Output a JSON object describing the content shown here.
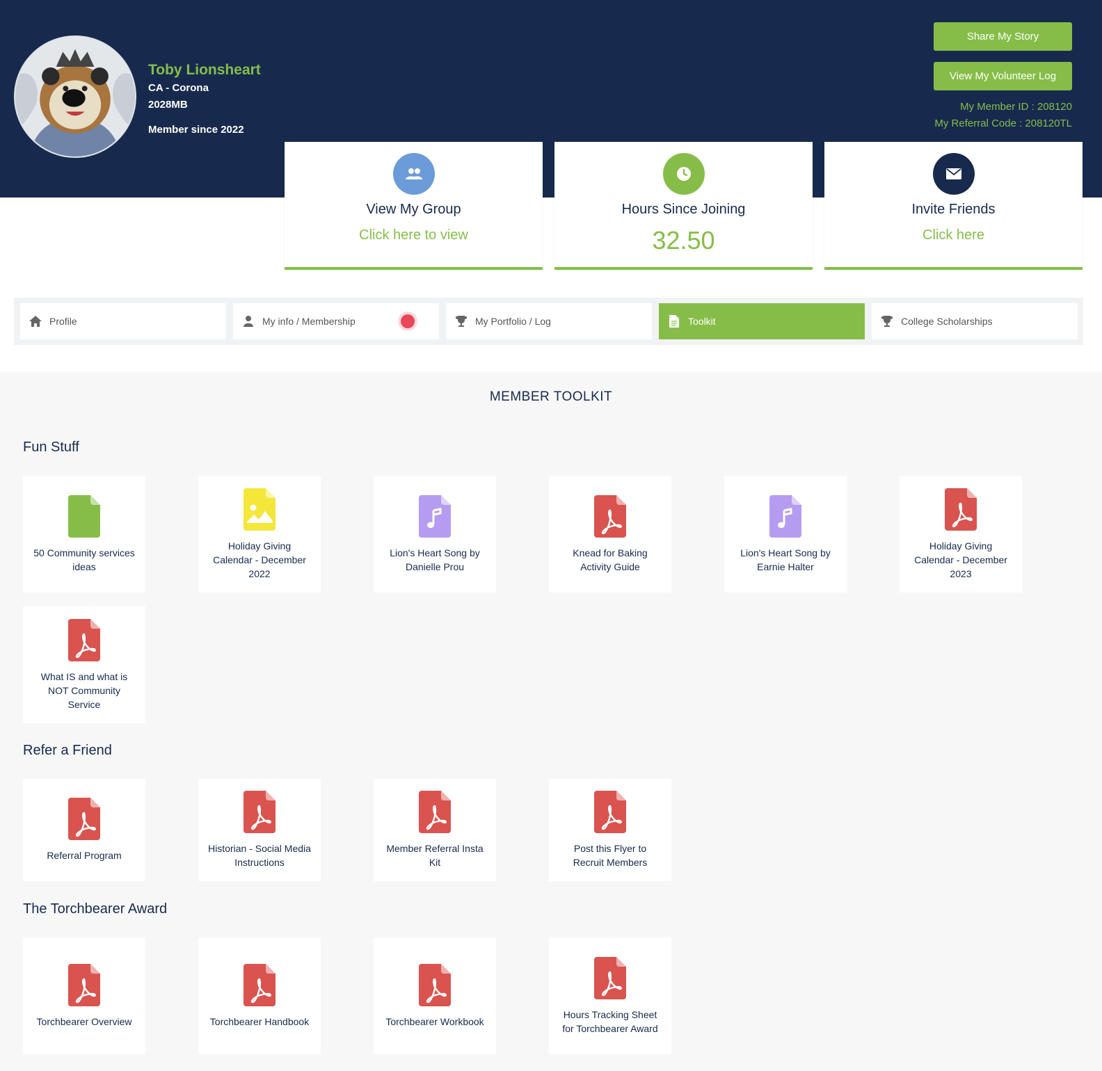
{
  "profile": {
    "name": "Toby Lionsheart",
    "location": "CA - Corona",
    "code": "2028MB",
    "member_since": "Member since 2022"
  },
  "header": {
    "share_button": "Share My Story",
    "log_button": "View My Volunteer Log",
    "member_id": "My Member ID : 208120",
    "referral_code": "My Referral Code : 208120TL"
  },
  "cards": {
    "group": {
      "icon": "users-icon",
      "title": "View My Group",
      "link": "Click here to view"
    },
    "hours": {
      "icon": "clock-icon",
      "title": "Hours Since Joining",
      "value": "32.50"
    },
    "invite": {
      "icon": "envelope-icon",
      "title": "Invite Friends",
      "link": "Click here"
    }
  },
  "tabs": [
    {
      "label": "Profile",
      "icon": "home-icon"
    },
    {
      "label": "My info / Membership",
      "icon": "user-icon"
    },
    {
      "label": "My Portfolio / Log",
      "icon": "trophy-icon"
    },
    {
      "label": "Toolkit",
      "icon": "document-icon",
      "active": true
    },
    {
      "label": "College Scholarships",
      "icon": "trophy-icon"
    }
  ],
  "toolkit": {
    "title": "MEMBER TOOLKIT",
    "sections": [
      {
        "title": "Fun Stuff",
        "items": [
          {
            "label": "50 Community services ideas",
            "icon": "document-icon"
          },
          {
            "label": "Holiday Giving Calendar - December 2022",
            "icon": "image-file-icon"
          },
          {
            "label": "Lion's Heart Song by Danielle Prou",
            "icon": "music-file-icon"
          },
          {
            "label": "Knead for Baking Activity Guide",
            "icon": "pdf-icon"
          },
          {
            "label": "Lion's Heart Song by Earnie Halter",
            "icon": "music-file-icon"
          },
          {
            "label": "Holiday Giving Calendar - December 2023",
            "icon": "pdf-icon"
          },
          {
            "label": "What IS and what is NOT Community Service",
            "icon": "pdf-icon"
          }
        ]
      },
      {
        "title": "Refer a Friend",
        "items": [
          {
            "label": "Referral Program",
            "icon": "pdf-icon"
          },
          {
            "label": "Historian - Social Media Instructions",
            "icon": "pdf-icon"
          },
          {
            "label": "Member Referral Insta Kit",
            "icon": "pdf-icon"
          },
          {
            "label": "Post this Flyer to Recruit Members",
            "icon": "pdf-icon"
          }
        ]
      },
      {
        "title": "The Torchbearer Award",
        "items": [
          {
            "label": "Torchbearer Overview",
            "icon": "pdf-icon"
          },
          {
            "label": "Torchbearer Handbook",
            "icon": "pdf-icon"
          },
          {
            "label": "Torchbearer Workbook",
            "icon": "pdf-icon"
          },
          {
            "label": "Hours Tracking Sheet for Torchbearer Award",
            "icon": "pdf-icon"
          }
        ]
      }
    ]
  },
  "colors": {
    "navy": "#172a4e",
    "green": "#86bd48",
    "blue": "#6b9bd8",
    "pdf": "#d9534f",
    "music": "#b59cf0",
    "image": "#f5e63a",
    "doc": "#86bd48"
  }
}
